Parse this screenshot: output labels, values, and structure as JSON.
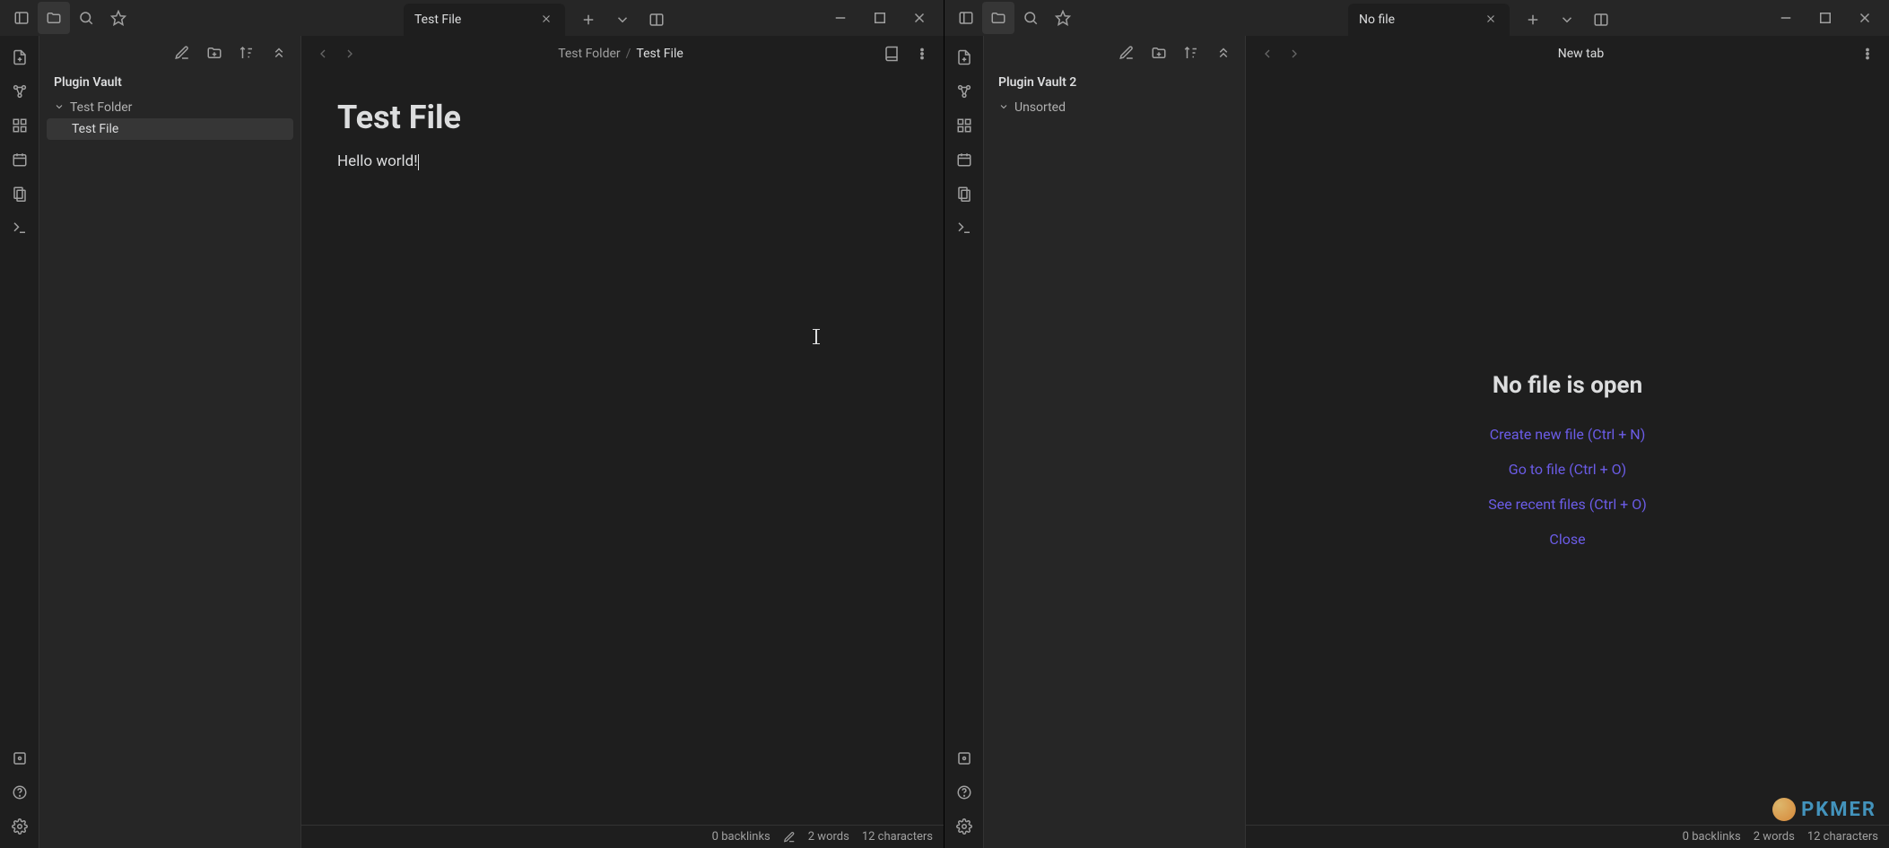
{
  "left": {
    "titlebar": {
      "tab_label": "Test File"
    },
    "sidebar": {
      "vault_name": "Plugin Vault",
      "folder": "Test Folder",
      "file": "Test File"
    },
    "editor": {
      "breadcrumb_folder": "Test Folder",
      "breadcrumb_sep": "/",
      "breadcrumb_file": "Test File",
      "note_title": "Test File",
      "note_body": "Hello world!"
    },
    "status": {
      "backlinks": "0 backlinks",
      "words": "2 words",
      "chars": "12 characters"
    }
  },
  "right": {
    "titlebar": {
      "tab_label": "No file"
    },
    "sidebar": {
      "vault_name": "Plugin Vault 2",
      "folder": "Unsorted"
    },
    "editor": {
      "header_label": "New tab",
      "empty_title": "No file is open",
      "links": {
        "create": "Create new file (Ctrl + N)",
        "goto": "Go to file (Ctrl + O)",
        "recent": "See recent files (Ctrl + O)",
        "close": "Close"
      }
    },
    "status": {
      "backlinks": "0 backlinks",
      "words": "2 words",
      "chars": "12 characters"
    }
  },
  "watermark": "PKMER"
}
